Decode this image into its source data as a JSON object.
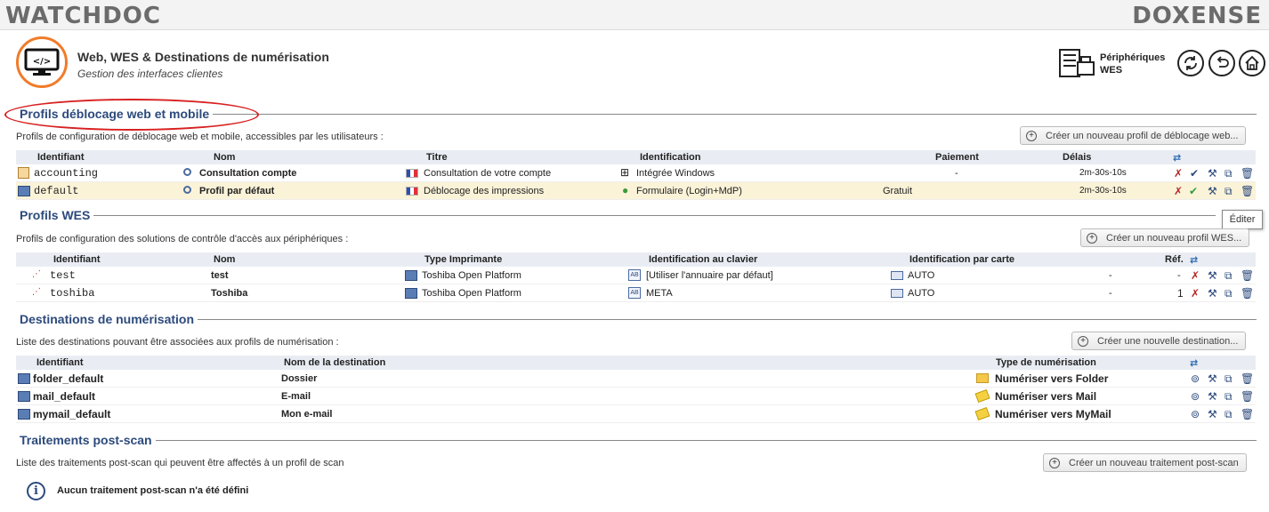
{
  "brand": {
    "left": "WATCHDOC",
    "right": "DOXENSE"
  },
  "header": {
    "title": "Web, WES & Destinations de numérisation",
    "subtitle": "Gestion des interfaces clientes",
    "devices_label_1": "Périphériques",
    "devices_label_2": "WES"
  },
  "web_profiles": {
    "title": "Profils déblocage web et mobile",
    "description": "Profils de configuration de déblocage web et mobile, accessibles par les utilisateurs :",
    "create_button": "Créer un nouveau profil de déblocage web...",
    "columns": [
      "Identifiant",
      "Nom",
      "Titre",
      "Identification",
      "Paiement",
      "Délais"
    ],
    "rows": [
      {
        "id": "accounting",
        "name": "Consultation compte",
        "title": "Consultation de votre compte",
        "identification": "Intégrée Windows",
        "payment": "-",
        "delay": "2m-30s-10s"
      },
      {
        "id": "default",
        "name": "Profil par défaut",
        "title": "Déblocage des impressions",
        "identification": "Formulaire (Login+MdP)",
        "payment": "Gratuit",
        "delay": "2m-30s-10s"
      }
    ]
  },
  "wes_profiles": {
    "title": "Profils WES",
    "description": "Profils de configuration des solutions de contrôle d'accès aux périphériques :",
    "create_button": "Créer un nouveau profil WES...",
    "columns": [
      "Identifiant",
      "Nom",
      "Type Imprimante",
      "Identification au clavier",
      "Identification par carte",
      "Réf."
    ],
    "rows": [
      {
        "id": "test",
        "name": "test",
        "printer_type": "Toshiba Open Platform",
        "keyboard_id": "[Utiliser l'annuaire par défaut]",
        "card_id": "AUTO",
        "dash": "-",
        "ref": "-"
      },
      {
        "id": "toshiba",
        "name": "Toshiba",
        "printer_type": "Toshiba Open Platform",
        "keyboard_id": "META",
        "card_id": "AUTO",
        "dash": "-",
        "ref": "1"
      }
    ]
  },
  "scan_destinations": {
    "title": "Destinations de numérisation",
    "description": "Liste des destinations pouvant être associées aux profils de numérisation :",
    "create_button": "Créer une nouvelle destination...",
    "columns": [
      "Identifiant",
      "Nom de la destination",
      "Type de numérisation"
    ],
    "rows": [
      {
        "id": "folder_default",
        "name": "Dossier",
        "type": "Numériser vers Folder"
      },
      {
        "id": "mail_default",
        "name": "E-mail",
        "type": "Numériser vers Mail"
      },
      {
        "id": "mymail_default",
        "name": "Mon e-mail",
        "type": "Numériser vers MyMail"
      }
    ]
  },
  "post_scan": {
    "title": "Traitements post-scan",
    "description": "Liste des traitements post-scan qui peuvent être affectés à un profil de scan",
    "create_button": "Créer un nouveau traitement post-scan",
    "empty_message": "Aucun traitement post-scan n'a été défini"
  },
  "tooltip": "Éditer"
}
